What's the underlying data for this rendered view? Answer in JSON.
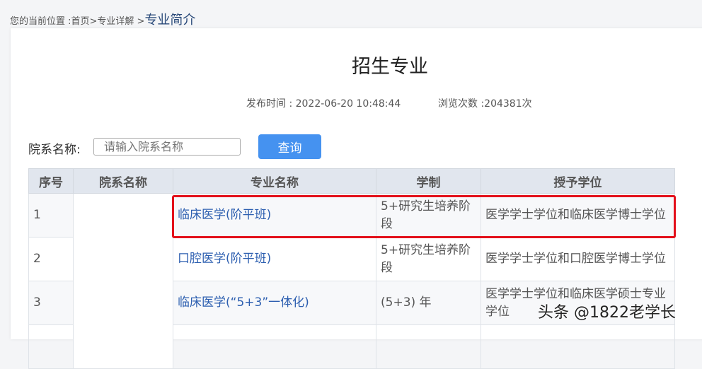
{
  "breadcrumb": {
    "prefix": "您的当前位置 :首页>专业详解 >",
    "current": "专业简介"
  },
  "title": "招生专业",
  "meta": {
    "publish": "发布时间 : 2022-06-20 10:48:44",
    "views": "浏览次数 :204381次"
  },
  "search": {
    "label": "院系名称:",
    "placeholder": "请输入院系名称",
    "button": "查询"
  },
  "table": {
    "headers": [
      "序号",
      "院系名称",
      "专业名称",
      "学制",
      "授予学位"
    ],
    "rows": [
      {
        "no": "1",
        "dept": "",
        "major": "临床医学(阶平班)",
        "length": "5+研究生培养阶段",
        "degree": "医学学士学位和临床医学博士学位"
      },
      {
        "no": "2",
        "dept": "",
        "major": "口腔医学(阶平班)",
        "length": "5+研究生培养阶段",
        "degree": "医学学士学位和口腔医学博士学位"
      },
      {
        "no": "3",
        "dept": "",
        "major": "临床医学(“5+3”一体化)",
        "length": " (5+3) 年",
        "degree": "医学学士学位和临床医学硕士专业学位"
      }
    ]
  },
  "watermark": "头条 @1822老学长",
  "colors": {
    "highlight": "#e3101a",
    "button": "#4592f0",
    "link": "#2d5fb0"
  }
}
